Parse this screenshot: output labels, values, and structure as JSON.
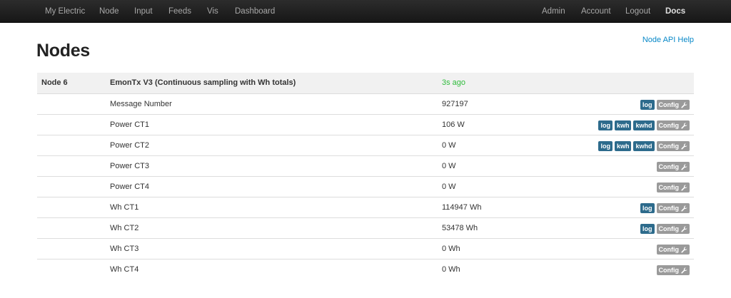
{
  "nav": {
    "left": [
      "My Electric",
      "Node",
      "Input",
      "Feeds",
      "Vis",
      "Dashboard"
    ],
    "right": [
      "Admin",
      "Account",
      "Logout",
      "Docs"
    ]
  },
  "page": {
    "title": "Nodes",
    "help_link": "Node API Help"
  },
  "node": {
    "id": "Node 6",
    "name": "EmonTx V3 (Continuous sampling with Wh totals)",
    "updated": "3s ago"
  },
  "rows": [
    {
      "name": "Message Number",
      "value": "927197",
      "badges": [
        "log"
      ]
    },
    {
      "name": "Power CT1",
      "value": "106 W",
      "badges": [
        "log",
        "kwh",
        "kwhd"
      ]
    },
    {
      "name": "Power CT2",
      "value": "0 W",
      "badges": [
        "log",
        "kwh",
        "kwhd"
      ]
    },
    {
      "name": "Power CT3",
      "value": "0 W",
      "badges": []
    },
    {
      "name": "Power CT4",
      "value": "0 W",
      "badges": []
    },
    {
      "name": "Wh CT1",
      "value": "114947 Wh",
      "badges": [
        "log"
      ]
    },
    {
      "name": "Wh CT2",
      "value": "53478 Wh",
      "badges": [
        "log"
      ]
    },
    {
      "name": "Wh CT3",
      "value": "0 Wh",
      "badges": []
    },
    {
      "name": "Wh CT4",
      "value": "0 Wh",
      "badges": []
    }
  ],
  "config_label": "Config",
  "icons": {
    "config": "wrench-icon"
  },
  "colors": {
    "badge": "#2d6b8c",
    "config": "#9a9a9a",
    "time_green": "#2ebb3b",
    "link": "#0888c8"
  }
}
